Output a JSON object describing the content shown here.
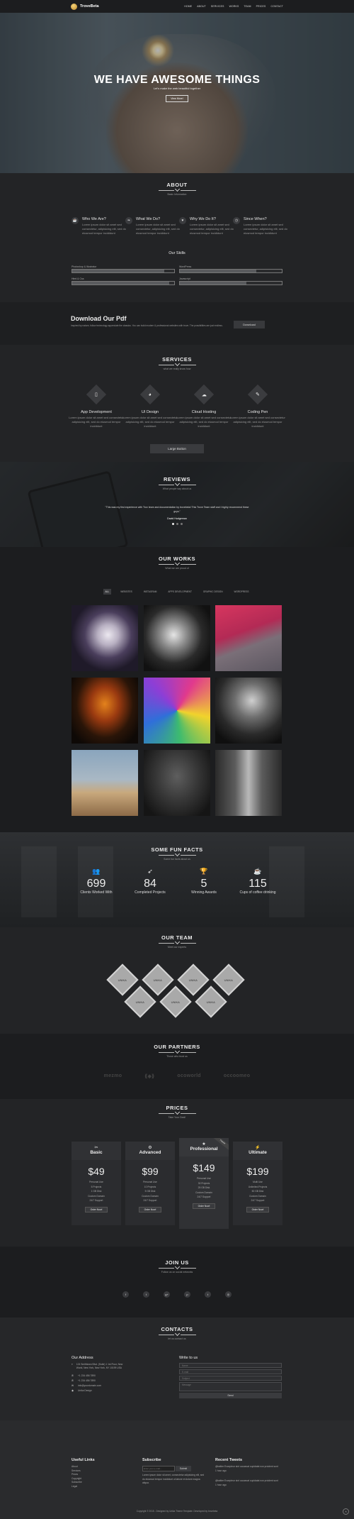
{
  "brand": {
    "name": "TroveBeta"
  },
  "nav": [
    "HOME",
    "ABOUT",
    "SERVICES",
    "WORKS",
    "TEAM",
    "PRICES",
    "CONTACT"
  ],
  "hero": {
    "title": "WE HAVE AWESOME THINGS",
    "subtitle": "Let's make the web beautiful together",
    "button": "View More!"
  },
  "about": {
    "title": "ABOUT",
    "subtitle": "Basic Information",
    "features": [
      {
        "icon": "cup-icon",
        "glyph": "☕",
        "title": "Who We Are?",
        "text": "Lorem ipsum dolor sit amet sed consectetur, adipisicing elit, sed do eiusmod tempor incididunt"
      },
      {
        "icon": "leaf-icon",
        "glyph": "❧",
        "title": "What We Do?",
        "text": "Lorem ipsum dolor sit amet sed consectetur, adipisicing elit, sed do eiusmod tempor incididunt"
      },
      {
        "icon": "heart-icon",
        "glyph": "♥",
        "title": "Why We Do It?",
        "text": "Lorem ipsum dolor sit amet sed consectetur, adipisicing elit, sed do eiusmod tempor incididunt"
      },
      {
        "icon": "clock-icon",
        "glyph": "◷",
        "title": "Since When?",
        "text": "Lorem ipsum dolor sit amet sed consectetur, adipisicing elit, sed do eiusmod tempor incididunt"
      }
    ],
    "skills_title": "Our Skills",
    "skills": [
      {
        "name": "Photoshop & Illustrator",
        "level": 0.9
      },
      {
        "name": "WordPress",
        "level": 0.75
      },
      {
        "name": "Html & Css",
        "level": 0.95
      },
      {
        "name": "Javascript",
        "level": 0.65
      }
    ]
  },
  "pdf": {
    "title": "Download Our Pdf",
    "text": "Inspired by nature, follow technology appreciate the classics. You can build modern & professional websites with trove. The possibilities are just endless.",
    "button": "Download"
  },
  "services": {
    "title": "SERVICES",
    "subtitle": "what we really know how",
    "items": [
      {
        "icon": "phone-icon",
        "glyph": "▯",
        "title": "App Development",
        "text": "Lorem ipsum dolor sit amet sed consectetur adipisicing elit, sed do eiusmod tempor incididunt"
      },
      {
        "icon": "chart-icon",
        "glyph": "◕",
        "title": "UI Design",
        "text": "Lorem ipsum dolor sit amet sed consectetur adipisicing elit, sed do eiusmod tempor incididunt"
      },
      {
        "icon": "cloud-icon",
        "glyph": "☁",
        "title": "Cloud Hosting",
        "text": "Lorem ipsum dolor sit amet sed consectetur adipisicing elit, sed do eiusmod tempor incididunt"
      },
      {
        "icon": "pen-icon",
        "glyph": "✎",
        "title": "Coding Pen",
        "text": "Lorem ipsum dolor sit amet sed consectetur adipisicing elit, sed do eiusmod tempor incididunt"
      }
    ],
    "button": "Large Button"
  },
  "reviews": {
    "title": "REVIEWS",
    "subtitle": "What people say about us",
    "quote": "\"This was my first experience with Trov team and documentation by trovebeta! This Trove Team staff and i highly recommend these guys.\"",
    "author": "David Hodgeman"
  },
  "works": {
    "title": "OUR WORKS",
    "subtitle": "What we are proud of",
    "filters": [
      "ALL",
      "WEBSITES",
      "INSTAGRAM",
      "APPS DEVELOPMENT",
      "GRAPHIC DESIGN",
      "WORDPRESS"
    ]
  },
  "facts": {
    "title": "SOME FUN FACTS",
    "subtitle": "Some fun facts about us",
    "items": [
      {
        "icon": "users-icon",
        "glyph": "👥",
        "number": "699",
        "label": "Clients Worked With"
      },
      {
        "icon": "rocket-icon",
        "glyph": "➶",
        "number": "84",
        "label": "Completed Projects"
      },
      {
        "icon": "trophy-icon",
        "glyph": "🏆",
        "number": "5",
        "label": "Winning Awards"
      },
      {
        "icon": "coffee-icon",
        "glyph": "☕",
        "number": "115",
        "label": "Cups of coffee drinking"
      }
    ]
  },
  "team": {
    "title": "OUR TEAM",
    "subtitle": "Meet our experts",
    "member_label": "UNIKA"
  },
  "partners": {
    "title": "OUR PARTNERS",
    "subtitle": "Those who trust us",
    "logos": [
      "mezmo",
      "⟪◈⟫",
      "ocoworld",
      "occoomeo"
    ]
  },
  "prices": {
    "title": "PRICES",
    "subtitle": "Take Your Deal!",
    "plans": [
      {
        "icon": "wrench-icon",
        "glyph": "✂",
        "name": "Basic",
        "price": "$49",
        "features": [
          "Personal Use",
          "5 Projects",
          "1 GB Disk",
          "Custom Domain",
          "24/7 Support"
        ],
        "button": "Order Now!"
      },
      {
        "icon": "gear-icon",
        "glyph": "⚙",
        "name": "Advanced",
        "price": "$99",
        "features": [
          "Personal Use",
          "10 Projects",
          "5 GB Disk",
          "Custom Domain",
          "24/7 Support"
        ],
        "button": "Order Now!"
      },
      {
        "icon": "star-icon",
        "glyph": "★",
        "name": "Professional",
        "price": "$149",
        "features": [
          "Personal Use",
          "30 Projects",
          "25 GB Disk",
          "Custom Domain",
          "24/7 Support"
        ],
        "button": "Order Now!",
        "ribbon": "Popular"
      },
      {
        "icon": "lightning-icon",
        "glyph": "⚡",
        "name": "Ultimate",
        "price": "$199",
        "features": [
          "Multi Use",
          "Unlimited Projects",
          "50 GB Disk",
          "Custom Domain",
          "24/7 Support"
        ],
        "button": "Order Now!"
      }
    ]
  },
  "join": {
    "title": "JOIN US",
    "subtitle": "Follow us on social networks",
    "social": [
      {
        "icon": "facebook-icon",
        "glyph": "f"
      },
      {
        "icon": "twitter-icon",
        "glyph": "t"
      },
      {
        "icon": "googleplus-icon",
        "glyph": "g+"
      },
      {
        "icon": "pinterest-icon",
        "glyph": "p"
      },
      {
        "icon": "tumblr-icon",
        "glyph": "t"
      },
      {
        "icon": "instagram-icon",
        "glyph": "◎"
      }
    ]
  },
  "contacts": {
    "title": "CONTACTS",
    "subtitle": "let us contact us",
    "address_title": "Our Address",
    "address": [
      {
        "icon": "location-icon",
        "glyph": "⌖",
        "text": "124 Smithtown Blvd. (Suite) 1 1st Floor, New World, New York, New York, NY 10199 USA"
      },
      {
        "icon": "phone-icon",
        "glyph": "✆",
        "text": "+1 234 456 7890"
      },
      {
        "icon": "fax-icon",
        "glyph": "✆",
        "text": "+1 234 456 7890"
      },
      {
        "icon": "mail-icon",
        "glyph": "✉",
        "text": "info@yourdomain.com"
      },
      {
        "icon": "skype-icon",
        "glyph": "◉",
        "text": "Unika Design"
      }
    ],
    "form_title": "Write to us",
    "form": {
      "name": "Name",
      "email": "E-mail",
      "subject": "Subject",
      "message": "Message",
      "send": "Send"
    }
  },
  "footer": {
    "links_title": "Useful Links",
    "links": [
      "About",
      "Services",
      "Prices",
      "Copyright",
      "Subscribe",
      "Legal"
    ],
    "subscribe_title": "Subscribe",
    "subscribe_placeholder": "Enter your e-mail...",
    "subscribe_button": "Submit",
    "subscribe_text": "Lorem ipsum dolor sit amet, consectetur adipisicing elit, sed do eiusmod tempor incididunt ut labore et dolore magna aliqua.",
    "tweets_title": "Recent Tweets",
    "tweets": [
      {
        "text": "@twitter Excepteur sint occaecat cupidatat non proident sunt",
        "time": "1 hour ago"
      },
      {
        "text": "@twitter Excepteur sint occaecat cupidatat non proident sunt",
        "time": "1 hour ago"
      }
    ],
    "copyright": "Copyright © 2015 - Designed by Unika Theme Template. Developed by trovebeta"
  }
}
